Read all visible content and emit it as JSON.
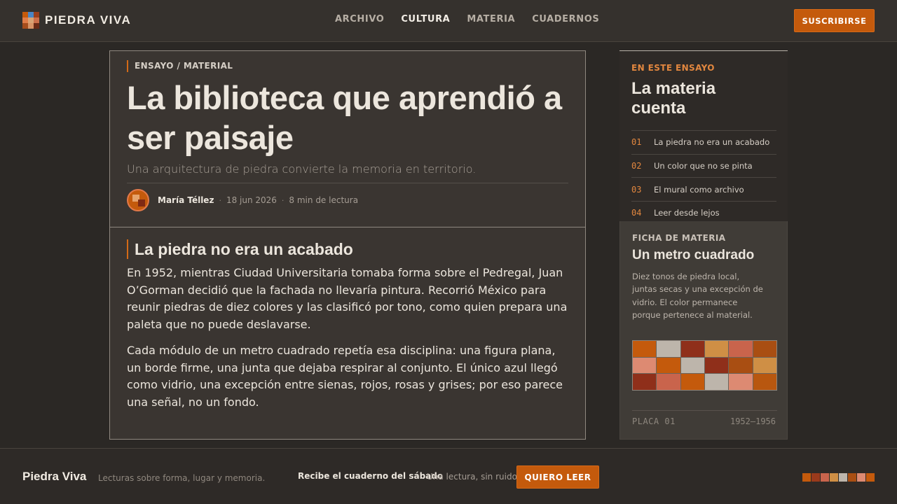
{
  "header": {
    "brand": "PIEDRA VIVA",
    "nav": [
      {
        "label": "ARCHIVO",
        "active": false
      },
      {
        "label": "CULTURA",
        "active": true
      },
      {
        "label": "MATERIA",
        "active": false
      },
      {
        "label": "CUADERNOS",
        "active": false
      }
    ],
    "subscribe_label": "SUSCRIBIRSE"
  },
  "colors": {
    "accent": "#c45a0c",
    "background": "#2b2825",
    "logo": [
      "#c45a0c",
      "#4a86c5",
      "#9a3f1c",
      "#e07c47",
      "#d8a374",
      "#cc6f4a",
      "#a54d1c",
      "#d89366",
      "#6b2a16"
    ]
  },
  "article": {
    "kicker": "ENSAYO / MATERIAL",
    "title": "La biblioteca que aprendió a ser paisaje",
    "subtitle": "Una arquitectura de piedra convierte la memoria en territorio.",
    "author": "María Téllez",
    "date": "18 jun 2026",
    "read_time": "8 min de lectura",
    "section_title": "La piedra no era un acabado",
    "paragraphs": [
      "En 1952, mientras Ciudad Universitaria tomaba forma sobre el Pedregal, Juan O’Gorman decidió que la fachada no llevaría pintura. Recorrió México para reunir piedras de diez colores y las clasificó por tono, como quien prepara una paleta que no puede deslavarse.",
      "Cada módulo de un metro cuadrado repetía esa disciplina: una figura plana, un borde firme, una junta que dejaba respirar al conjunto. El único azul llegó como vidrio, una excepción entre sienas, rojos, rosas y grises; por eso parece una señal, no un fondo."
    ]
  },
  "toc": {
    "label": "EN ESTE ENSAYO",
    "title": "La materia cuenta",
    "items": [
      {
        "num": "01",
        "text": "La piedra no era un acabado"
      },
      {
        "num": "02",
        "text": "Un color que no se pinta"
      },
      {
        "num": "03",
        "text": "El mural como archivo"
      },
      {
        "num": "04",
        "text": "Leer desde lejos"
      }
    ]
  },
  "material": {
    "label": "FICHA DE MATERIA",
    "title": "Un metro cuadrado",
    "description": "Diez tonos de piedra local, juntas secas y una excepción de vidrio. El color permanece porque pertenece al material.",
    "swatches": [
      "#c45a0c",
      "#bdb5ab",
      "#8f2f1a",
      "#cf8f45",
      "#c9644c",
      "#a94e12",
      "#dd8a72",
      "#c45a0c",
      "#bdb5ab",
      "#8f2f1a",
      "#a94e12",
      "#cf8f45",
      "#8f2f1a",
      "#c9644c",
      "#c45a0c",
      "#bdb5ab",
      "#dd8a72",
      "#b8570f"
    ],
    "plate": "PLACA 01",
    "years": "1952–1956"
  },
  "footer": {
    "brand": "Piedra Viva",
    "tagline": "Lecturas sobre forma, lugar y memoria.",
    "newsletter": "Recibe el cuaderno del sábado",
    "quiet": "Una lectura, sin ruido.",
    "cta": "QUIERO LEER",
    "swatches": [
      "#c45a0c",
      "#9a3a1c",
      "#c9644c",
      "#cf8f45",
      "#bdb5ab",
      "#a94e12",
      "#dd8a72",
      "#c45a0c"
    ]
  }
}
